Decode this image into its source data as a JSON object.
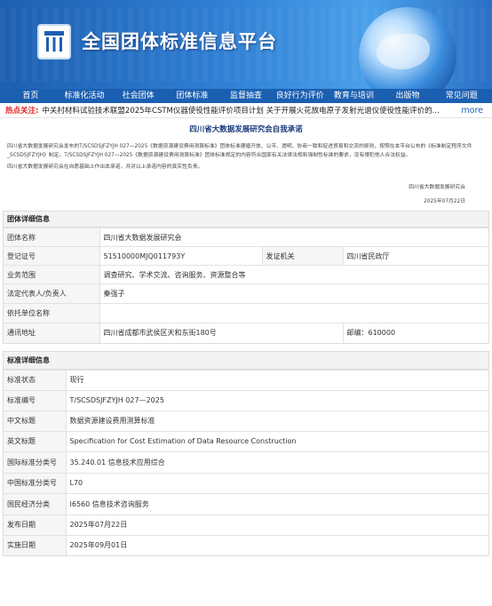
{
  "site": {
    "title": "全国团体标准信息平台"
  },
  "nav": [
    "首页",
    "标准化活动",
    "社会团体",
    "团体标准",
    "监督抽查",
    "良好行为评价",
    "教育与培训",
    "出版物",
    "常见问题"
  ],
  "ticker": {
    "label": "热点关注:",
    "text": "中关村材料试验技术联盟2025年CSTM仪器使役性能评价项目计划 关于开展火花放电原子发射光谱仪使役性能评价的...",
    "more": "more"
  },
  "commitment": {
    "title": "四川省大数据发展研究会自我承诺",
    "p1": "四川省大数据发展研究会发布的T/SCSDSJFZYJH 027—2025《数据资源建设费用测算标准》团体标准遵循开放、公平、透明、协商一致和促进贸易和交流的原则，按照在本平台公布的《标准制定程序文件_SCSDSJFZYJH》制定。T/SCSDSJFZYJH 027—2025《数据资源建设费用测算标准》团体标准规定的内容符合国家有关法律法规和强制性标准的要求，没有侵犯他人合法权益。",
    "p2": "四川省大数据发展研究会在自愿基础上作出本承诺，并对以上承诺内容的真实性负责。",
    "signer": "四川省大数据发展研究会",
    "date": "2025年07月22日"
  },
  "org": {
    "heading": "团体详细信息",
    "name_label": "团体名称",
    "name": "四川省大数据发展研究会",
    "reg_label": "登记证号",
    "reg": "51510000MJQ011793Y",
    "issuer_label": "发证机关",
    "issuer": "四川省民政厅",
    "scope_label": "业务范围",
    "scope": "调查研究、学术交流、咨询服务、资源整合等",
    "rep_label": "法定代表人/负责人",
    "rep": "秦强子",
    "sponsor_label": "依托单位名称",
    "sponsor": "",
    "addr_label": "通讯地址",
    "addr": "四川省成都市武侯区天和东街180号",
    "postcode": "邮编：610000"
  },
  "standard": {
    "heading": "标准详细信息",
    "rows": [
      {
        "k": "标准状态",
        "v": "现行"
      },
      {
        "k": "标准编号",
        "v": "T/SCSDSJFZYJH 027—2025"
      },
      {
        "k": "中文标题",
        "v": "数据资源建设费用测算标准"
      },
      {
        "k": "英文标题",
        "v": "Specification for Cost Estimation of Data Resource Construction"
      },
      {
        "k": "国际标准分类号",
        "v": "35.240.01 信息技术应用综合"
      },
      {
        "k": "中国标准分类号",
        "v": "L70"
      },
      {
        "k": "国民经济分类",
        "v": "I6560 信息技术咨询服务"
      },
      {
        "k": "发布日期",
        "v": "2025年07月22日"
      },
      {
        "k": "实施日期",
        "v": "2025年09月01日"
      }
    ]
  }
}
